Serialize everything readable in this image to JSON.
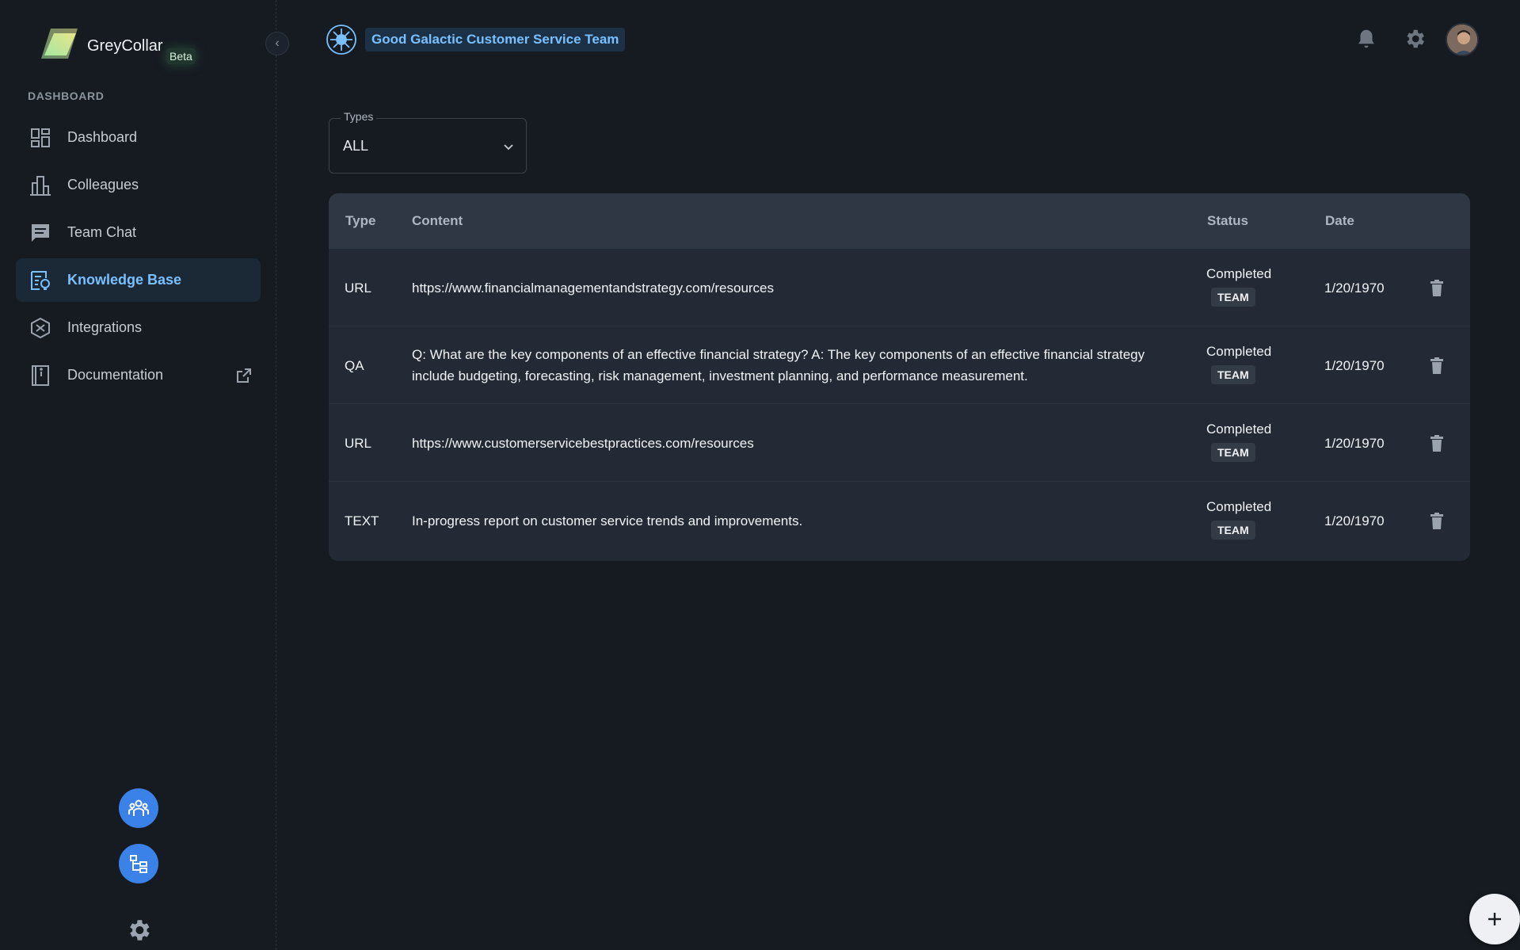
{
  "app": {
    "brand": "GreyCollar",
    "beta": "Beta"
  },
  "sidebar": {
    "section_label": "DASHBOARD",
    "items": [
      {
        "label": "Dashboard",
        "icon": "dashboard-icon"
      },
      {
        "label": "Colleagues",
        "icon": "building-icon"
      },
      {
        "label": "Team Chat",
        "icon": "chat-icon"
      },
      {
        "label": "Knowledge Base",
        "icon": "knowledge-icon",
        "active": true
      },
      {
        "label": "Integrations",
        "icon": "integrations-icon"
      },
      {
        "label": "Documentation",
        "icon": "book-icon",
        "external": true
      }
    ]
  },
  "header": {
    "team_name": "Good Galactic Customer Service Team"
  },
  "filter": {
    "legend": "Types",
    "value": "ALL"
  },
  "table": {
    "headers": {
      "type": "Type",
      "content": "Content",
      "status": "Status",
      "date": "Date"
    },
    "rows": [
      {
        "type": "URL",
        "content": "https://www.financialmanagementandstrategy.com/resources",
        "status": "Completed",
        "badge": "TEAM",
        "date": "1/20/1970"
      },
      {
        "type": "QA",
        "content": "Q: What are the key components of an effective financial strategy? A: The key components of an effective financial strategy include budgeting, forecasting, risk management, investment planning, and performance measurement.",
        "status": "Completed",
        "badge": "TEAM",
        "date": "1/20/1970"
      },
      {
        "type": "URL",
        "content": "https://www.customerservicebestpractices.com/resources",
        "status": "Completed",
        "badge": "TEAM",
        "date": "1/20/1970"
      },
      {
        "type": "TEXT",
        "content": "In-progress report on customer service trends and improvements.",
        "status": "Completed",
        "badge": "TEAM",
        "date": "1/20/1970"
      }
    ]
  },
  "colors": {
    "accent": "#79c0ff",
    "round_button": "#3b82e8",
    "background": "#161b22",
    "card": "#232a35"
  }
}
